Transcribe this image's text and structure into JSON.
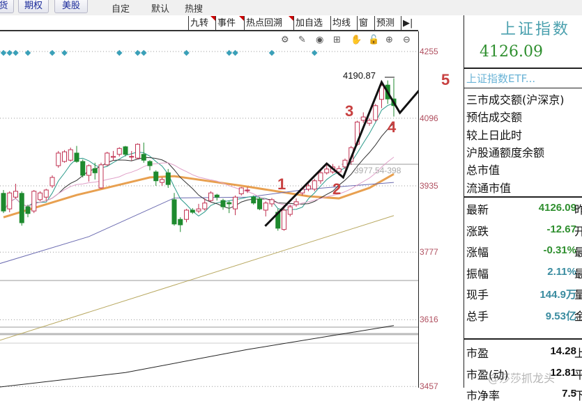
{
  "tabs": {
    "buttons": [
      "货",
      "期权",
      "美股"
    ],
    "texts": [
      "自定",
      "默认",
      "热搜"
    ]
  },
  "toolbar": {
    "items": [
      {
        "label": "九转",
        "flag": true
      },
      {
        "label": "事件",
        "flag": true
      },
      {
        "label": "热点回溯",
        "flag": true
      },
      {
        "label": "加自选",
        "flag": false
      },
      {
        "label": "均线",
        "flag": false
      },
      {
        "label": "窗",
        "flag": false
      },
      {
        "label": "预测",
        "flag": false
      },
      {
        "label": "▶|",
        "flag": false
      }
    ]
  },
  "chart_icons": [
    "⚙",
    "✎",
    "◉",
    "⊞",
    "✋",
    "🔓",
    "⊕",
    "⊖"
  ],
  "panel": {
    "title": "上证指数",
    "price": "4126.09",
    "etf": "上证指数ETF...",
    "info": [
      "三市成交额(沪深京)",
      "预估成交额",
      "较上日此时",
      "沪股通额度余额",
      "总市值",
      "流通市值"
    ],
    "stats": [
      {
        "label": "最新",
        "value": "4126.09",
        "suffix": "昨",
        "color": "#2f8f2f"
      },
      {
        "label": "涨跌",
        "value": "-12.67",
        "suffix": "开",
        "color": "#2f8f2f"
      },
      {
        "label": "涨幅",
        "value": "-0.31%",
        "suffix": "最",
        "color": "#2f8f2f"
      },
      {
        "label": "振幅",
        "value": "2.11%",
        "suffix": "最",
        "color": "#3a8ca0"
      },
      {
        "label": "现手",
        "value": "144.9万",
        "suffix": "量",
        "color": "#3a8ca0"
      },
      {
        "label": "总手",
        "value": "9.53亿",
        "suffix": "金",
        "color": "#3a8ca0"
      }
    ],
    "valuation": [
      {
        "label": "市盈",
        "value": "14.28",
        "suffix": "上",
        "color": "#111"
      },
      {
        "label": "市盈(动)",
        "value": "12.81",
        "suffix": "平",
        "color": "#111"
      },
      {
        "label": "市净率",
        "value": "7.5",
        "suffix": "下",
        "color": "#111"
      }
    ]
  },
  "watermark": "@莎莎抓龙头",
  "chart_data": {
    "type": "candlestick",
    "y_ticks": [
      4255,
      4096,
      3935,
      3777,
      3616,
      3457
    ],
    "ylim": [
      3457,
      4255
    ],
    "peak_label": "4190.87",
    "range_label": "3977.54-398",
    "wave_labels": [
      "1",
      "2",
      "3",
      "4",
      "5"
    ],
    "wave_path": [
      [
        42.9,
        3839
      ],
      [
        53,
        3988
      ],
      [
        55.7,
        3955
      ],
      [
        62,
        4182
      ],
      [
        65,
        4109
      ],
      [
        72,
        4228
      ]
    ],
    "signal_markers": [
      0,
      1,
      2,
      4,
      8,
      10,
      19,
      22,
      23,
      30,
      37,
      38,
      44,
      51
    ],
    "ohlc": [
      [
        3917,
        3925,
        3870,
        3875
      ],
      [
        3880,
        3922,
        3872,
        3918
      ],
      [
        3908,
        3940,
        3905,
        3922
      ],
      [
        3917,
        3922,
        3840,
        3847
      ],
      [
        3885,
        3890,
        3860,
        3869
      ],
      [
        3875,
        3925,
        3870,
        3922
      ],
      [
        3902,
        3922,
        3898,
        3918
      ],
      [
        3908,
        3928,
        3900,
        3925
      ],
      [
        3935,
        3960,
        3930,
        3955
      ],
      [
        3983,
        4018,
        3978,
        4013
      ],
      [
        3993,
        4020,
        3990,
        4016
      ],
      [
        3996,
        4026,
        3993,
        4021
      ],
      [
        4013,
        4030,
        3990,
        3993
      ],
      [
        3993,
        3998,
        3955,
        3960
      ],
      [
        3960,
        3986,
        3945,
        3983
      ],
      [
        3976,
        3990,
        3950,
        3966
      ],
      [
        3930,
        3990,
        3928,
        3985
      ],
      [
        3985,
        4016,
        3982,
        4013
      ],
      [
        4003,
        4018,
        3995,
        4005
      ],
      [
        4010,
        4027,
        4005,
        4024
      ],
      [
        4028,
        4030,
        4005,
        4010
      ],
      [
        4004,
        4018,
        3995,
        4005
      ],
      [
        4001,
        4036,
        3998,
        4034
      ],
      [
        4010,
        4038,
        3990,
        3996
      ],
      [
        3993,
        3996,
        3972,
        3983
      ],
      [
        3968,
        3972,
        3935,
        3947
      ],
      [
        3943,
        3955,
        3935,
        3950
      ],
      [
        3966,
        3975,
        3930,
        3938
      ],
      [
        3902,
        3918,
        3840,
        3844
      ],
      [
        3855,
        3860,
        3825,
        3842
      ],
      [
        3855,
        3880,
        3848,
        3877
      ],
      [
        3877,
        3882,
        3868,
        3872
      ],
      [
        3875,
        3892,
        3870,
        3880
      ],
      [
        3880,
        3905,
        3876,
        3894
      ],
      [
        3900,
        3922,
        3896,
        3918
      ],
      [
        3913,
        3916,
        3900,
        3908
      ],
      [
        3900,
        3904,
        3878,
        3885
      ],
      [
        3895,
        3900,
        3870,
        3892
      ],
      [
        3880,
        3912,
        3865,
        3908
      ],
      [
        3916,
        3932,
        3912,
        3930
      ],
      [
        3924,
        3932,
        3918,
        3925
      ],
      [
        3908,
        3912,
        3890,
        3894
      ],
      [
        3904,
        3908,
        3877,
        3880
      ],
      [
        3877,
        3898,
        3862,
        3894
      ],
      [
        3892,
        3906,
        3885,
        3902
      ],
      [
        3872,
        3880,
        3828,
        3834
      ],
      [
        3831,
        3888,
        3828,
        3877
      ],
      [
        3867,
        3890,
        3862,
        3885
      ],
      [
        3890,
        3905,
        3885,
        3897
      ],
      [
        3918,
        3930,
        3912,
        3927
      ],
      [
        3927,
        3940,
        3922,
        3935
      ],
      [
        3927,
        3952,
        3922,
        3947
      ],
      [
        3947,
        3972,
        3940,
        3966
      ],
      [
        3966,
        3985,
        3962,
        3975
      ],
      [
        3968,
        3987,
        3964,
        3980
      ],
      [
        3968,
        3983,
        3960,
        3976
      ],
      [
        3980,
        4000,
        3975,
        3996
      ],
      [
        3993,
        4030,
        3985,
        4026
      ],
      [
        4034,
        4090,
        4030,
        4087
      ],
      [
        4091,
        4110,
        4085,
        4099
      ],
      [
        4084,
        4096,
        4078,
        4091
      ],
      [
        4092,
        4130,
        4088,
        4126
      ],
      [
        4141,
        4182,
        4120,
        4174
      ],
      [
        4175,
        4186,
        4130,
        4142
      ],
      [
        4142,
        4190.87,
        4100,
        4126.09
      ]
    ],
    "moving_averages": [
      {
        "period": 5,
        "color": "#2a9a8a"
      },
      {
        "period": 10,
        "color": "#333333"
      },
      {
        "period": 20,
        "color": "#e0a0c8"
      }
    ],
    "overlays": [
      {
        "name": "orange",
        "color": "#e8a050",
        "points": [
          [
            0,
            3860
          ],
          [
            12,
            3913
          ],
          [
            24,
            3955
          ],
          [
            28,
            3958
          ],
          [
            40,
            3933
          ],
          [
            50,
            3910
          ],
          [
            55,
            3905
          ],
          [
            60,
            3930
          ],
          [
            64,
            3963
          ]
        ]
      },
      {
        "name": "purple",
        "color": "#6a6ab0",
        "points": [
          [
            -1,
            3748
          ],
          [
            14,
            3814
          ],
          [
            28,
            3906
          ],
          [
            40,
            3908
          ],
          [
            50,
            3927
          ],
          [
            64,
            3943
          ]
        ]
      },
      {
        "name": "olive",
        "color": "#b8a860",
        "points": [
          [
            -1,
            3565
          ],
          [
            64,
            3864
          ]
        ]
      },
      {
        "name": "black",
        "color": "#222222",
        "points": [
          [
            -1,
            3455
          ],
          [
            20,
            3490
          ],
          [
            40,
            3545
          ],
          [
            64,
            3602
          ]
        ]
      }
    ]
  }
}
